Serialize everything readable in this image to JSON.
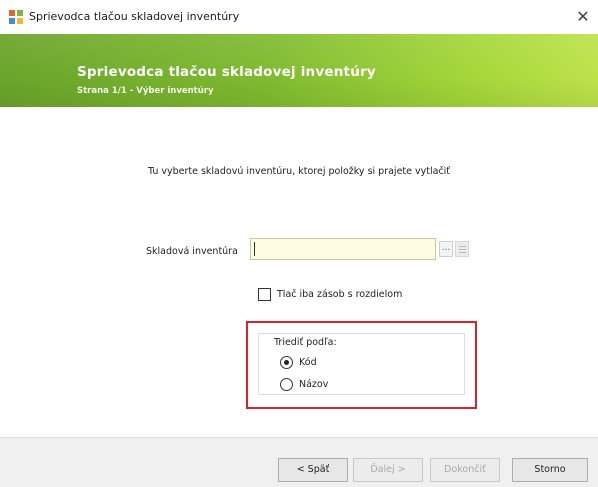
{
  "window": {
    "title": "Sprievodca tlačou skladovej inventúry",
    "close_glyph": "✕"
  },
  "header": {
    "title": "Sprievodca tlačou skladovej inventúry",
    "subtitle": "Strana 1/1 - Výber inventúry",
    "gradient_colors": [
      "#6aa42a",
      "#7fbb30",
      "#a6d73a",
      "#bde24a"
    ]
  },
  "content": {
    "instruction": "Tu vyberte skladovú inventúru, ktorej položky si prajete vytlačiť",
    "inventory_field": {
      "label": "Skladová inventúra",
      "value": "",
      "browse_label": "...",
      "browse_icon": "ellipsis-icon",
      "clear_icon": "clear-icon"
    },
    "only_difference_checkbox": {
      "label": "Tlač iba zásob s rozdielom",
      "checked": false
    },
    "sort_group": {
      "legend": "Triediť podľa:",
      "options": [
        {
          "label": "Kód",
          "selected": true
        },
        {
          "label": "Názov",
          "selected": false
        }
      ],
      "highlight_color": "#d8222c"
    }
  },
  "footer": {
    "back_label": "< Späť",
    "next_label": "Ďalej >",
    "finish_label": "Dokončiť",
    "cancel_label": "Storno",
    "next_enabled": false,
    "finish_enabled": false
  }
}
